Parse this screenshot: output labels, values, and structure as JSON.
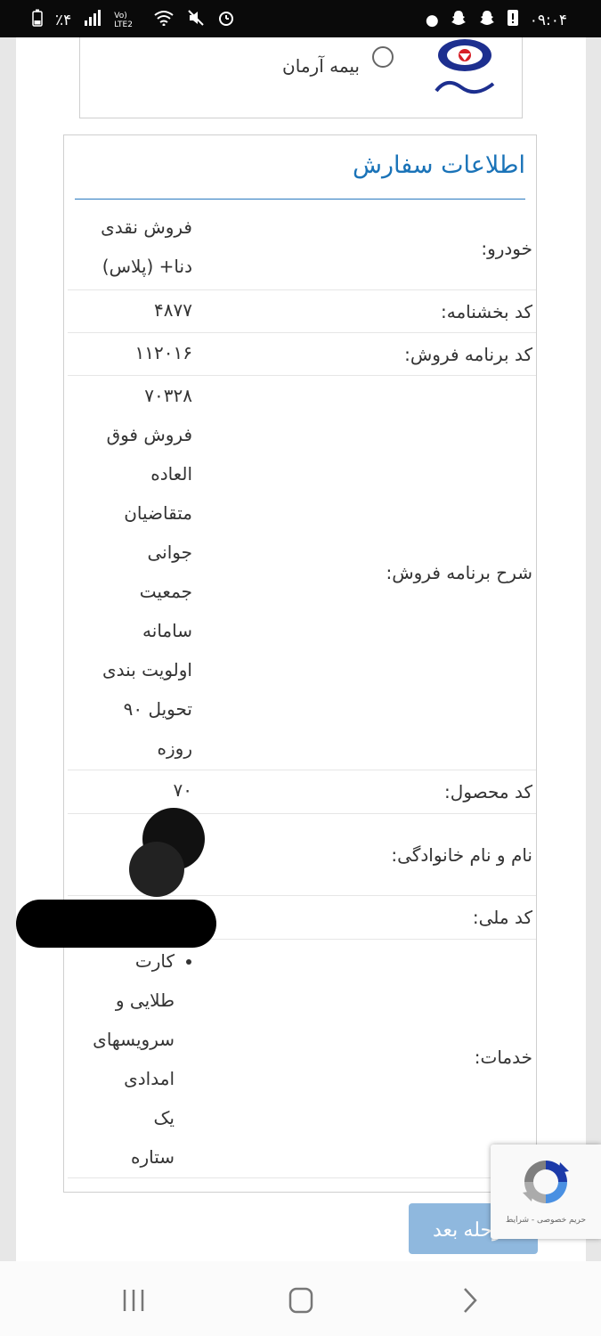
{
  "status_bar": {
    "time": "۰۹:۰۴",
    "battery": "٪۴",
    "network": "Vo) LTE2"
  },
  "insurer": {
    "label": "بیمه آرمان",
    "logo_text": "بیمه آرمان"
  },
  "order": {
    "title": "اطلاعات سفارش",
    "rows": [
      {
        "label": "خودرو:",
        "value_lines": [
          "فروش نقدی",
          "دنا+ (پلاس)"
        ]
      },
      {
        "label": "کد بخشنامه:",
        "value_lines": [
          "۴۸۷۷"
        ]
      },
      {
        "label": "کد برنامه فروش:",
        "value_lines": [
          "۱۱۲۰۱۶"
        ]
      },
      {
        "label": "شرح برنامه فروش:",
        "value_lines": [
          "۷۰۳۲۸",
          "فروش فوق",
          "العاده",
          "متقاضیان",
          "جوانی",
          "جمعیت",
          "سامانه",
          "اولویت بندی",
          "تحویل ۹۰",
          "روزه"
        ]
      },
      {
        "label": "کد محصول:",
        "value_lines": [
          "۷۰"
        ]
      },
      {
        "label": "نام و نام خانوادگی:",
        "value_lines": [
          ""
        ]
      },
      {
        "label": "کد ملی:",
        "value_lines": [
          ""
        ]
      },
      {
        "label": "خدمات:",
        "service_lines": [
          "کارت",
          "طلایی و",
          "سرویسهای",
          "امدادی",
          "یک",
          "ستاره"
        ]
      }
    ]
  },
  "buttons": {
    "next": "مرحله بعد"
  },
  "recaptcha": {
    "footer": "حریم خصوصی - شرایط"
  },
  "icons": {
    "status_left": [
      "battery-icon",
      "signal-icon",
      "lte-icon",
      "wifi-icon",
      "mute-icon",
      "alarm-icon"
    ],
    "status_right": [
      "dot-icon",
      "snapchat-icon",
      "snapchat-icon",
      "alert-icon"
    ],
    "nav": [
      "recents-icon",
      "home-icon",
      "back-icon"
    ]
  },
  "colors": {
    "accent": "#1a73b8",
    "button": "#8fb8de",
    "status_bar": "#0a0a0a"
  }
}
